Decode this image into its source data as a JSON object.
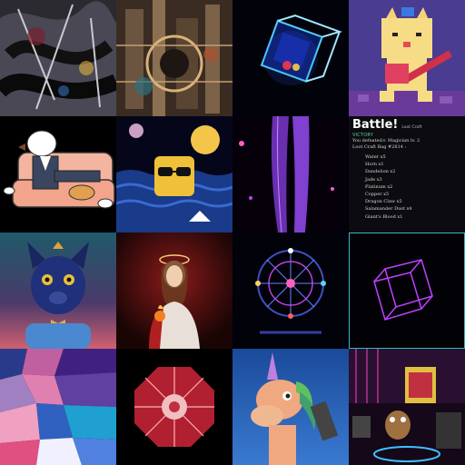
{
  "gallery": {
    "battle_card": {
      "title": "Battle!",
      "tag": "Loot Craft",
      "status": "VICTORY",
      "defeated_line": "You defeated⚔ Magician lv. 2",
      "bag_line": "Loot Craft Bag #2814 :",
      "items": [
        "Water x5",
        "Horn x1",
        "Dandelion x2",
        "Jade x3",
        "Platinum x2",
        "Copper x5",
        "Dragon Claw x5",
        "Salamander Dust x4",
        "Giant's Blood x1"
      ]
    }
  }
}
